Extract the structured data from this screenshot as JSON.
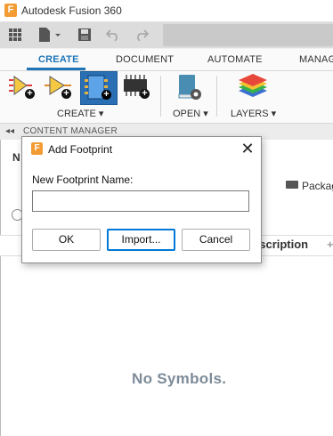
{
  "window": {
    "title": "Autodesk Fusion 360",
    "logo_letter": "F"
  },
  "tabs": [
    {
      "label": "CREATE",
      "active": true
    },
    {
      "label": "DOCUMENT",
      "active": false
    },
    {
      "label": "AUTOMATE",
      "active": false
    },
    {
      "label": "MANAG",
      "active": false
    }
  ],
  "ribbon": {
    "create_label": "CREATE ▾",
    "open_label": "OPEN ▾",
    "layers_label": "LAYERS ▾"
  },
  "content_manager": {
    "title": "CONTENT MANAGER",
    "fragment_n": "N",
    "fragment_s": "s",
    "packages_fragment": "Packag",
    "description_fragment": "escription",
    "empty_message": "No Symbols."
  },
  "dialog": {
    "logo_letter": "F",
    "title": "Add Footprint",
    "close_glyph": "✕",
    "field_label": "New Footprint Name:",
    "field_value": "",
    "ok_label": "OK",
    "import_label": "Import...",
    "cancel_label": "Cancel"
  },
  "colors": {
    "accent": "#1f75b7",
    "brand": "#f39c34",
    "focus": "#0078d7"
  }
}
